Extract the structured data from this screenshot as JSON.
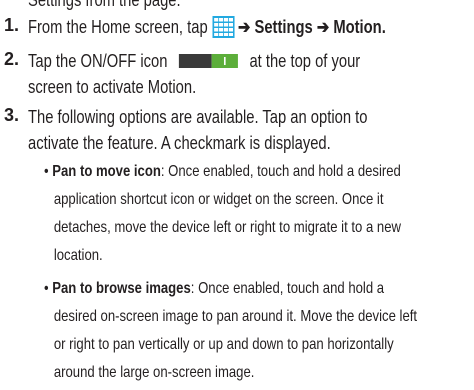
{
  "top_clipped_text": "Settings from the page.",
  "steps": [
    {
      "number": "1.",
      "line1_pre": "From the Home screen, tap",
      "arrow1": "➔",
      "settings": "Settings",
      "arrow2": "➔",
      "motion": "Motion",
      "period": "."
    },
    {
      "number": "2.",
      "line1_pre": "Tap the ON/OFF icon",
      "line1_post": "at the top of your",
      "line2": "screen to activate Motion."
    },
    {
      "number": "3.",
      "line1": "The following options are available. Tap an option to",
      "line2": "activate the feature. A checkmark is displayed."
    }
  ],
  "bullets": [
    {
      "dot": "•",
      "title": "Pan to move icon",
      "lines": [
        ": Once enabled, touch and hold a desired",
        "application shortcut icon or widget on the screen. Once it",
        "detaches, move the device left or right to migrate it to a new",
        "location."
      ]
    },
    {
      "dot": "•",
      "title": "Pan to browse images",
      "lines": [
        ": Once enabled, touch and hold a",
        "desired on-screen image to pan around it. Move the device left",
        "or right to pan vertically or up and down to pan horizontally",
        "around the large on-screen image."
      ]
    }
  ],
  "colors": {
    "text": "#231f20",
    "apps_icon": "#22a9e0",
    "toggle_off": "#3a3a3a",
    "toggle_on": "#5cae3a"
  },
  "icons": {
    "apps": "apps-grid-icon",
    "toggle": "on-off-toggle-icon"
  }
}
